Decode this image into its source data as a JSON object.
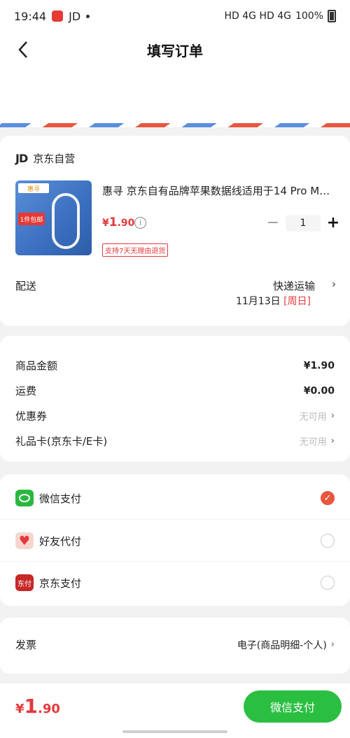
{
  "status_bar": {
    "time": "19:44",
    "carrier": "JD",
    "right": "HD 4G HD 4G",
    "battery": "100%"
  },
  "nav": {
    "title": "填写订单"
  },
  "shop": {
    "name": "京东自营",
    "product": {
      "title": "惠寻 京东自有品牌苹果数据线适用于14 Pro Max...",
      "price_yen": "¥",
      "price_int": "1",
      "price_dec": ".90",
      "quantity": "1",
      "return_tag": "支持7天无理由退货",
      "image_brand": "惠寻",
      "image_badge": "1件包邮"
    },
    "shipping": {
      "label": "配送",
      "method": "快递运输",
      "date": "11月13日",
      "day": "[周日]"
    }
  },
  "summary": [
    {
      "label": "商品金额",
      "value": "¥1.90"
    },
    {
      "label": "运费",
      "value": "¥0.00"
    },
    {
      "label": "优惠券",
      "value": "无可用"
    },
    {
      "label": "礼品卡(京东卡/E卡)",
      "value": "无可用"
    }
  ],
  "payment": [
    {
      "label": "微信支付",
      "icon": "wechat-icon",
      "selected": true
    },
    {
      "label": "好友代付",
      "icon": "friend-pay-icon",
      "selected": false
    },
    {
      "label": "京东支付",
      "icon": "jd-pay-icon",
      "icon_text": "东付",
      "selected": false
    }
  ],
  "invoice": {
    "label": "发票",
    "value": "电子(商品明细-个人)"
  },
  "bottom": {
    "total_yen": "¥",
    "total_int": "1",
    "total_dec": ".90",
    "submit": "微信支付"
  },
  "colors": {
    "accent": "#e4393c",
    "wechat": "#2ab73f",
    "radio_on": "#e8563d"
  }
}
